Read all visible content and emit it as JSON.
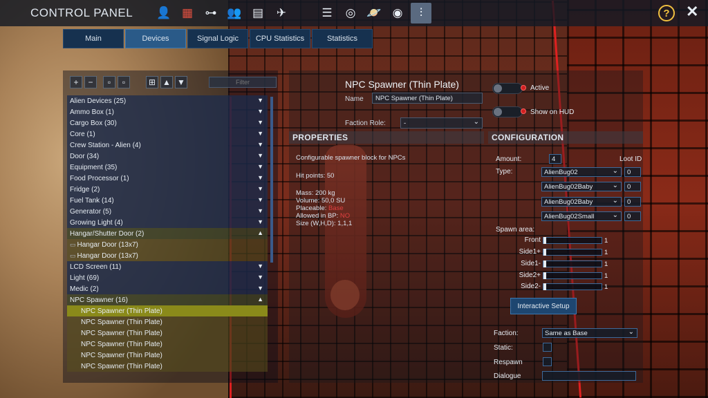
{
  "app": {
    "title": "CONTROL PANEL"
  },
  "topbar": {
    "icons": [
      "user-icon",
      "faction-tree-icon",
      "signal-tree-icon",
      "players-icon",
      "log-icon",
      "vehicle-icon",
      "list-icon",
      "compass-icon",
      "planet-icon",
      "galaxy-icon",
      "settings-sliders-icon"
    ],
    "help": "?",
    "close": "✕"
  },
  "tabs": [
    {
      "label": "Main"
    },
    {
      "label": "Devices"
    },
    {
      "label": "Signal Logic"
    },
    {
      "label": "CPU Statistics"
    },
    {
      "label": "Statistics"
    }
  ],
  "filter": {
    "placeholder": "Filter"
  },
  "devices": {
    "items": [
      {
        "label": "Alien Devices (25)",
        "type": "group"
      },
      {
        "label": "Ammo Box (1)",
        "type": "group"
      },
      {
        "label": "Cargo Box (30)",
        "type": "group"
      },
      {
        "label": "Core (1)",
        "type": "group"
      },
      {
        "label": "Crew Station - Alien (4)",
        "type": "group"
      },
      {
        "label": "Door (34)",
        "type": "group"
      },
      {
        "label": "Equipment (35)",
        "type": "group"
      },
      {
        "label": "Food Processor (1)",
        "type": "group"
      },
      {
        "label": "Fridge (2)",
        "type": "group"
      },
      {
        "label": "Fuel Tank (14)",
        "type": "group"
      },
      {
        "label": "Generator (5)",
        "type": "group"
      },
      {
        "label": "Growing Light (4)",
        "type": "group"
      },
      {
        "label": "Hangar/Shutter Door (2)",
        "type": "group-open"
      },
      {
        "label": "Hangar Door (13x7)",
        "type": "child"
      },
      {
        "label": "Hangar Door (13x7)",
        "type": "child"
      },
      {
        "label": "LCD Screen (11)",
        "type": "group"
      },
      {
        "label": "Light (69)",
        "type": "group"
      },
      {
        "label": "Medic (2)",
        "type": "group"
      },
      {
        "label": "NPC Spawner (16)",
        "type": "group-open"
      },
      {
        "label": "NPC Spawner (Thin Plate)",
        "type": "child-selected"
      },
      {
        "label": "NPC Spawner (Thin Plate)",
        "type": "child"
      },
      {
        "label": "NPC Spawner (Thin Plate)",
        "type": "child"
      },
      {
        "label": "NPC Spawner (Thin Plate)",
        "type": "child"
      },
      {
        "label": "NPC Spawner (Thin Plate)",
        "type": "child"
      },
      {
        "label": "NPC Spawner (Thin Plate)",
        "type": "child"
      }
    ]
  },
  "detail": {
    "title": "NPC Spawner (Thin Plate)",
    "name_label": "Name",
    "name_value": "NPC Spawner (Thin Plate)",
    "faction_role_label": "Faction Role:",
    "faction_role_value": "-",
    "active_label": "Active",
    "hud_label": "Show on HUD"
  },
  "properties": {
    "header": "PROPERTIES",
    "description": "Configurable spawner block for NPCs",
    "hit_points": "Hit points: 50",
    "mass": "Mass: 200 kg",
    "volume": "Volume: 50,0 SU",
    "placeable_label": "Placeable:",
    "placeable_value": "Base",
    "allowed_label": "Allowed in BP:",
    "allowed_value": "NO",
    "size": "Size (W,H,D): 1,1,1"
  },
  "configuration": {
    "header": "CONFIGURATION",
    "amount_label": "Amount:",
    "amount_value": "4",
    "loot_id_label": "Loot ID",
    "type_label": "Type:",
    "types": [
      {
        "value": "AlienBug02",
        "loot": "0"
      },
      {
        "value": "AlienBug02Baby",
        "loot": "0"
      },
      {
        "value": "AlienBug02Baby",
        "loot": "0"
      },
      {
        "value": "AlienBug02Small",
        "loot": "0"
      }
    ],
    "spawn_area_label": "Spawn area:",
    "spawn_area": [
      {
        "label": "Front",
        "value": "1"
      },
      {
        "label": "Side1+",
        "value": "1"
      },
      {
        "label": "Side1-",
        "value": "1"
      },
      {
        "label": "Side2+",
        "value": "1"
      },
      {
        "label": "Side2-",
        "value": "1"
      }
    ],
    "interactive_setup": "Interactive Setup",
    "faction_label": "Faction:",
    "faction_value": "Same as Base",
    "static_label": "Static:",
    "respawn_label": "Respawn",
    "dialogue_label": "Dialogue"
  }
}
